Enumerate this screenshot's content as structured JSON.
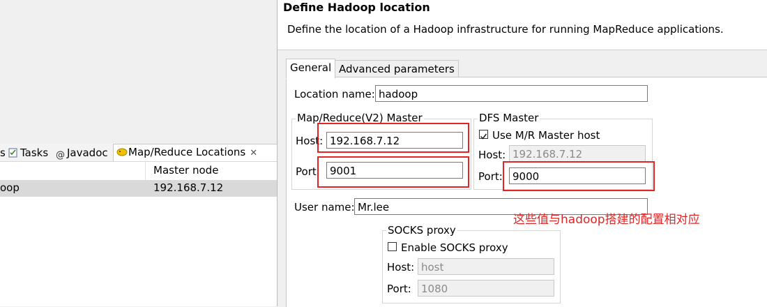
{
  "left_view": {
    "tabs": [
      {
        "label": "s"
      },
      {
        "label": "Tasks"
      },
      {
        "label": "Javadoc"
      },
      {
        "label": "Map/Reduce Locations"
      }
    ],
    "close_glyph": "✕",
    "column_header": "Master node",
    "row": {
      "name": "oop",
      "master_node": "192.168.7.12"
    }
  },
  "dialog": {
    "title": "Define Hadoop location",
    "description": "Define the location of a Hadoop infrastructure for running MapReduce applications.",
    "tabs": [
      "General",
      "Advanced parameters"
    ],
    "location_name_label": "Location name:",
    "location_name_value": "hadoop",
    "mr_group_title": "Map/Reduce(V2) Master",
    "mr_host_label": "Host:",
    "mr_host_value": "192.168.7.12",
    "mr_port_label": "Port:",
    "mr_port_value": "9001",
    "dfs_group_title": "DFS Master",
    "dfs_use_mr_label": "Use M/R Master host",
    "dfs_use_mr_checked": true,
    "dfs_host_label": "Host:",
    "dfs_host_value": "192.168.7.12",
    "dfs_port_label": "Port:",
    "dfs_port_value": "9000",
    "user_name_label": "User name:",
    "user_name_value": "Mr.lee",
    "socks_group_title": "SOCKS proxy",
    "socks_enable_label": "Enable SOCKS proxy",
    "socks_enable_checked": false,
    "socks_host_label": "Host:",
    "socks_host_value": "host",
    "socks_port_label": "Port:",
    "socks_port_value": "1080"
  },
  "annotation": {
    "note": "这些值与hadoop搭建的配置相对应",
    "color": "#e02525"
  }
}
